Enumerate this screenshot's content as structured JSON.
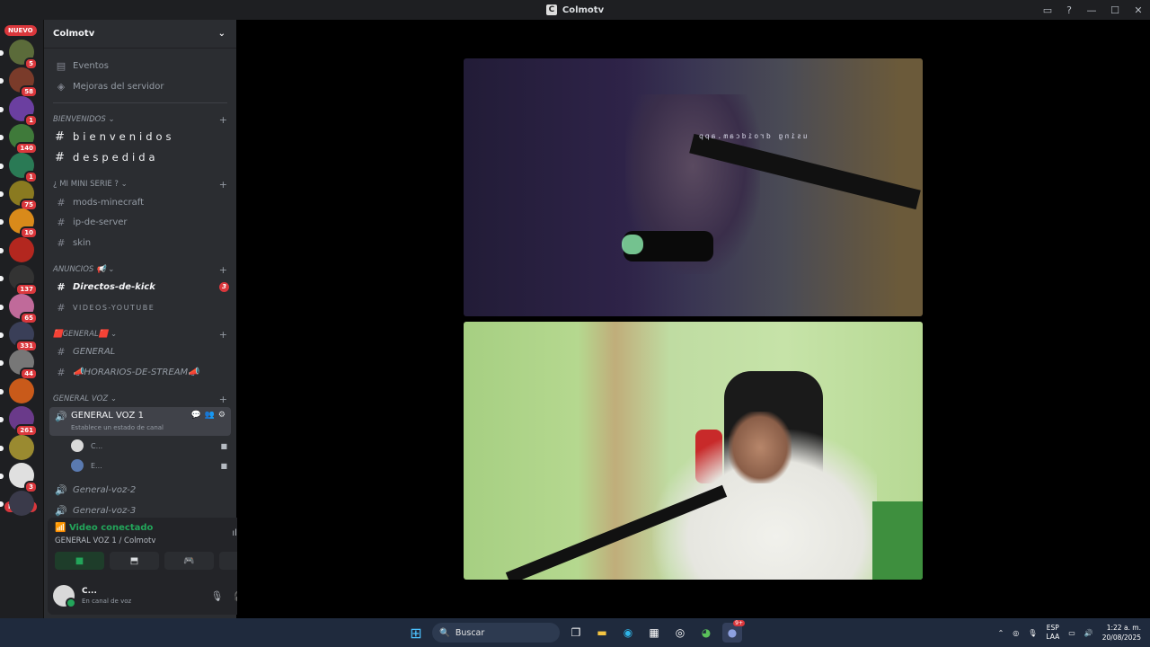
{
  "window": {
    "title": "Colmotv"
  },
  "guilds": {
    "nuevo_label": "NUEVO",
    "items": [
      {
        "badge": "5",
        "color": "#5b6b3a"
      },
      {
        "badge": "58",
        "color": "#7a3b2a"
      },
      {
        "badge": "1",
        "color": "#6b3fa0"
      },
      {
        "badge": "140",
        "color": "#3f7a3a"
      },
      {
        "badge": "1",
        "color": "#2a7a55"
      },
      {
        "badge": "75",
        "color": "#8a7a20"
      },
      {
        "badge": "10",
        "color": "#d98a1a"
      },
      {
        "badge": "",
        "color": "#b3271f"
      },
      {
        "badge": "137",
        "color": "#333333"
      },
      {
        "badge": "65",
        "color": "#c06a9a"
      },
      {
        "badge": "331",
        "color": "#3a3f58"
      },
      {
        "badge": "44",
        "color": "#777777"
      },
      {
        "badge": "",
        "color": "#c95a1a"
      },
      {
        "badge": "261",
        "color": "#6a3a8a"
      },
      {
        "badge": "",
        "color": "#9a8a30"
      },
      {
        "badge": "3",
        "color": "#e0e0e0"
      },
      {
        "badge": "",
        "color": "#3a3a4a"
      }
    ]
  },
  "server": {
    "name": "Colmotv",
    "top_items": [
      {
        "label": "Eventos",
        "icon": "calendar-icon"
      },
      {
        "label": "Mejoras del servidor",
        "icon": "boost-icon"
      }
    ],
    "categories": {
      "bienvenidos": "BIENVENIDOS",
      "mini_serie": "¿ MI MINI SERIE ?",
      "anuncios": "ANUNCIOS 📢",
      "general": "🟥GENERAL🟥",
      "general_voz": "GENERAL VOZ"
    },
    "channels": {
      "bienvenidos": "bienvenidos",
      "despedida": "despedida",
      "mods": "mods-minecraft",
      "ip": "ip-de-server",
      "skin": "skin",
      "directos": "Directos-de-kick",
      "directos_badge": "3",
      "videos": "VIDEOS-YOUTUBE",
      "general": "GENERAL",
      "horarios": "📣HORARIOS-DE-STREAM📣",
      "voz1": "GENERAL VOZ 1",
      "voz1_status": "Establece un estado de canal",
      "voz_user1": "C...",
      "voz_user2": "E...",
      "voz2": "General-voz-2",
      "voz3": "General-voz-3"
    }
  },
  "voice_panel": {
    "status": "Video conectado",
    "location": "GENERAL VOZ 1 / Colmotv",
    "buttons": [
      "camera-icon",
      "screen-share-icon",
      "activity-icon",
      "soundboard-icon"
    ]
  },
  "user": {
    "name": "C...",
    "status": "En canal de voz"
  },
  "stage": {
    "watermark": "using droidcam.app"
  },
  "taskbar": {
    "search": "Buscar",
    "lang_top": "ESP",
    "lang_bottom": "LAA",
    "time": "1:22 a. m.",
    "date": "20/08/2025",
    "discord_badge": "9+"
  }
}
